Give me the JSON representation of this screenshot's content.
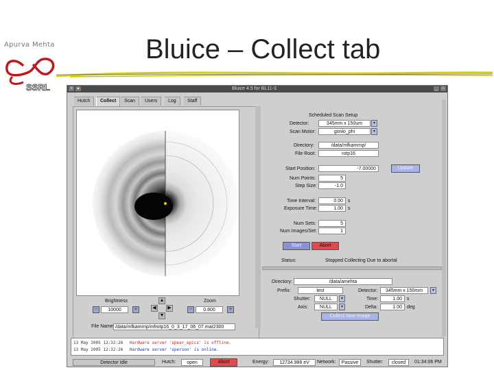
{
  "slide": {
    "author": "Apurva Mehta",
    "title": "Bluice – Collect tab",
    "logo_text": "SSRL"
  },
  "window": {
    "title": "Bluice 4.5 for BL11-3",
    "tabs": [
      "Hutch",
      "Collect",
      "Scan",
      "Users",
      "Log",
      "Staff"
    ],
    "active_tab": "Collect"
  },
  "scheduled": {
    "heading": "Scheduled Scan Setup",
    "fields": [
      {
        "label": "Detector:",
        "value": "345mm x 150um"
      },
      {
        "label": "Scan Motor:",
        "value": "gonio_phi"
      },
      {
        "label": "Directory:",
        "value": "/data/mfkamrnp/"
      },
      {
        "label": "File Root:",
        "value": "rotp16"
      },
      {
        "label": "Start Position:",
        "value": "-7.00000"
      },
      {
        "label": "Num Points:",
        "value": "5"
      },
      {
        "label": "Step Size:",
        "value": "-1.0"
      },
      {
        "label": "Time Interval:",
        "value": "0.00",
        "unit": "s"
      },
      {
        "label": "Exposure Time:",
        "value": "1.00",
        "unit": "s"
      },
      {
        "label": "Num Sets:",
        "value": "5"
      },
      {
        "label": "Num Images/Set:",
        "value": "1"
      }
    ],
    "update_label": "Update",
    "start_label": "Start",
    "abort_label": "Abort",
    "status_label": "Status:",
    "status_value": "Stopped Collecting Due to abortal"
  },
  "collect": {
    "directory_label": "Directory:",
    "directory_value": "/data/amehta",
    "prefix_label": "Prefix:",
    "prefix_value": "test",
    "shutter_label": "Shutter:",
    "shutter_value": "NULL",
    "axis_label": "Axis:",
    "axis_value": "NULL",
    "detector_label": "Detector:",
    "detector_value": "345mm x 150mm",
    "time_label": "Time:",
    "time_value": "1.00",
    "time_unit": "s",
    "delta_label": "Delta:",
    "delta_value": "1.00",
    "delta_unit": "deg",
    "collect_new_image_label": "Collect New Image"
  },
  "image_view": {
    "brightness_label": "Brightness",
    "brightness_value": "10000",
    "zoom_label": "Zoom",
    "zoom_value": "0.800",
    "filename_label": "File Name",
    "filename_value": "/data/mfkamrnp/mfrotp16_0_3_17_06_07.mar2300"
  },
  "log": {
    "lines": [
      {
        "time": "13 May 2005 12:32:26",
        "message": "Hardware server 'spear_epics' is offline.",
        "color": "#c81818"
      },
      {
        "time": "13 May 2005 12:32:26",
        "message": "Hardware server 'sperson' is online.",
        "color": "#1a2fb0"
      }
    ]
  },
  "statusbar": {
    "detector_status": "Detector Idle",
    "hutch_label": "Hutch:",
    "hutch_value": "open",
    "abort_label": "Abort",
    "energy_label": "Energy:",
    "energy_value": "12734.988 eV",
    "network_label": "Network:",
    "network_value": "Passive",
    "shutter_label": "Shutter:",
    "shutter_value": "closed",
    "clock": "01:34:06 PM"
  },
  "colors": {
    "start_button": "#8b93d6",
    "abort_button": "#e04a4a",
    "update_button": "#a8b4e8",
    "title_rule": "#d8d000"
  }
}
